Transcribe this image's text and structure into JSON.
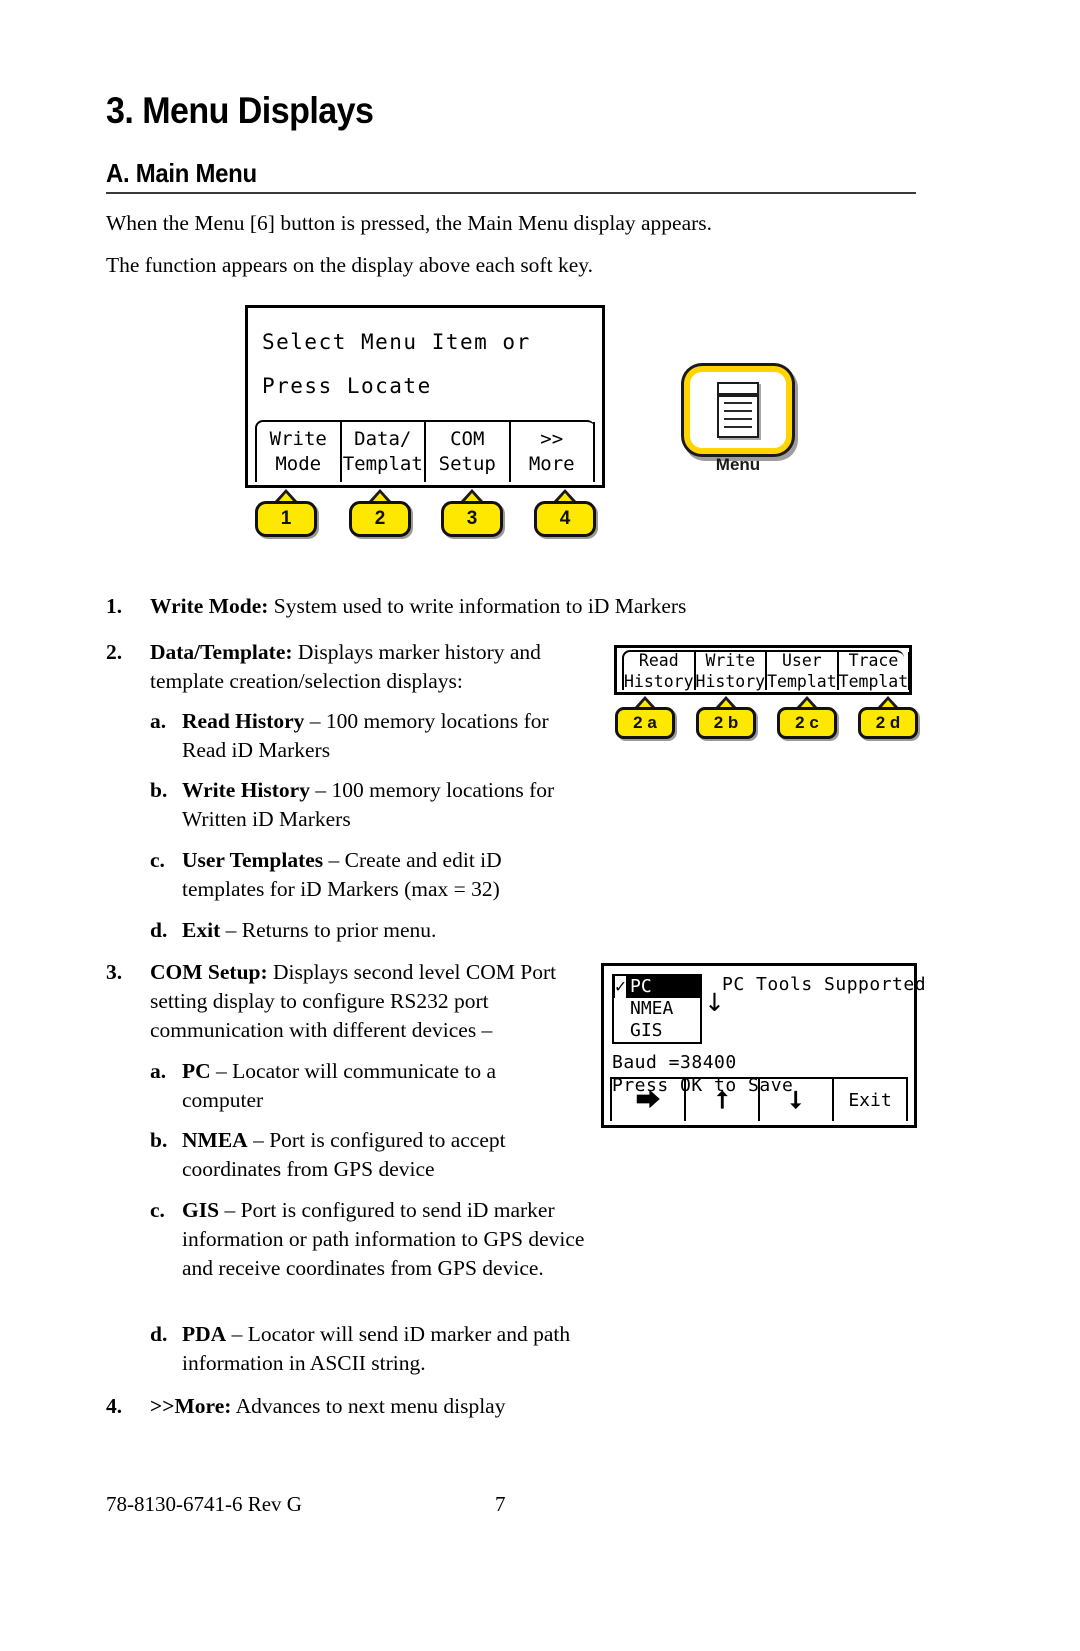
{
  "document": {
    "chapter_heading": "3. Menu Displays",
    "section_heading": "A. Main Menu",
    "intro_1": "When the Menu [6] button is pressed, the Main Menu display appears.",
    "intro_2": "The function appears on the display above each soft key."
  },
  "main_menu_screen": {
    "line1": "Select Menu Item or",
    "line2": "Press Locate",
    "softkeys": [
      {
        "top": "Write",
        "bottom": "Mode"
      },
      {
        "top": "Data/",
        "bottom": "Templat"
      },
      {
        "top": "COM",
        "bottom": "Setup"
      },
      {
        "top": ">>",
        "bottom": "More"
      }
    ],
    "keycaps": [
      "1",
      "2",
      "3",
      "4"
    ]
  },
  "menu_button": {
    "label": "Menu",
    "icon": "document-list-icon",
    "border_color": "#ffd400"
  },
  "data_template_screen": {
    "softkeys": [
      {
        "top": "Read",
        "bottom": "History"
      },
      {
        "top": "Write",
        "bottom": "History"
      },
      {
        "top": "User",
        "bottom": "Templat"
      },
      {
        "top": "Trace",
        "bottom": "Templat"
      }
    ],
    "keycaps": [
      "2 a",
      "2 b",
      "2 c",
      "2 d"
    ]
  },
  "com_setup_screen": {
    "options": [
      {
        "label": "PC",
        "selected": true
      },
      {
        "label": "NMEA",
        "selected": false
      },
      {
        "label": "GIS",
        "selected": false
      }
    ],
    "scroll_arrow": "↓",
    "title": "PC Tools Supported",
    "baud_line": "Baud =38400",
    "save_line": "Press OK to Save",
    "softkeys": [
      {
        "glyph": "⮕",
        "name": "right-arrow"
      },
      {
        "glyph": "⭡",
        "name": "up-arrow"
      },
      {
        "glyph": "⭣",
        "name": "down-arrow"
      },
      {
        "glyph": "Exit",
        "name": "exit"
      }
    ]
  },
  "list": {
    "item1": {
      "number": "1.",
      "term": "Write Mode:",
      "text": " System used to write information to iD Markers"
    },
    "item2": {
      "number": "2.",
      "term": "Data/Template:",
      "text": " Displays marker history and template creation/selection displays:",
      "subs": [
        {
          "letter": "a.",
          "term": "Read History",
          "text": " – 100 memory locations for Read iD Markers"
        },
        {
          "letter": "b.",
          "term": "Write History",
          "text": " – 100 memory locations for Written iD Markers"
        },
        {
          "letter": "c.",
          "term": "User Templates",
          "text": " – Create and edit iD templates for iD Markers (max = 32)"
        },
        {
          "letter": "d.",
          "term": "Exit",
          "text": " – Returns to prior menu."
        }
      ]
    },
    "item3": {
      "number": "3.",
      "term": "COM Setup:",
      "text": " Displays second level COM Port setting display to configure RS232 port communication with different devices –",
      "subs": [
        {
          "letter": "a.",
          "term": "PC",
          "text": " – Locator will communicate to a computer"
        },
        {
          "letter": "b.",
          "term": "NMEA",
          "text": " – Port is configured to accept coordinates from GPS device"
        },
        {
          "letter": "c.",
          "term": "GIS",
          "text": " – Port is configured to send iD marker information or path information to GPS device and receive coordinates from GPS device."
        },
        {
          "letter": "d.",
          "term": "PDA",
          "text": " – Locator will send iD marker and path information in ASCII string."
        }
      ]
    },
    "item4": {
      "number": "4.",
      "term": ">>More:",
      "text": " Advances to next menu display"
    }
  },
  "footer": {
    "left": "78-8130-6741-6 Rev G",
    "page": "7"
  }
}
